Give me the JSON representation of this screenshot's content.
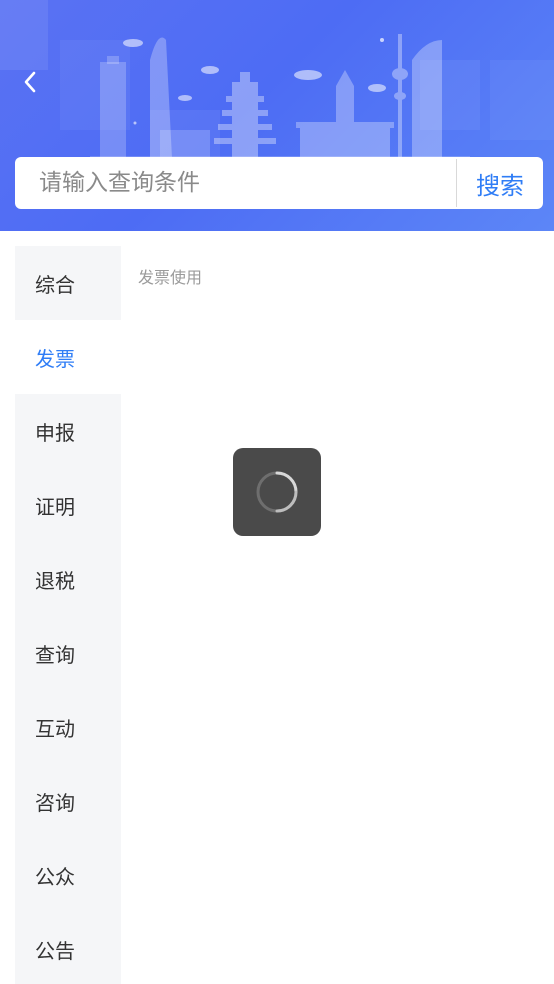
{
  "header": {
    "back_icon": "chevron-left-icon",
    "background_colors": [
      "#5a72f3",
      "#4d6cf4",
      "#5c86f7"
    ]
  },
  "search": {
    "placeholder": "请输入查询条件",
    "value": "",
    "button_label": "搜索"
  },
  "sidebar": {
    "active_index": 1,
    "items": [
      {
        "label": "综合"
      },
      {
        "label": "发票"
      },
      {
        "label": "申报"
      },
      {
        "label": "证明"
      },
      {
        "label": "退税"
      },
      {
        "label": "查询"
      },
      {
        "label": "互动"
      },
      {
        "label": "咨询"
      },
      {
        "label": "公众"
      },
      {
        "label": "公告"
      }
    ]
  },
  "content": {
    "section_title": "发票使用"
  },
  "loading": {
    "icon": "spinner-icon"
  },
  "colors": {
    "accent": "#2f7df6",
    "sidebar_bg": "#f5f6f8",
    "toast_bg": "#4a4a4a"
  }
}
